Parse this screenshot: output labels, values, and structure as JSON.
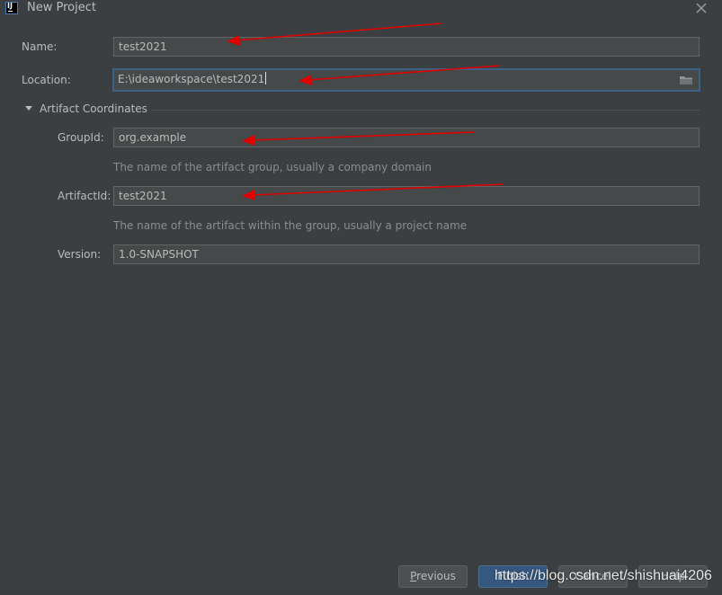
{
  "window": {
    "title": "New Project",
    "app_icon_letters": "IJ"
  },
  "form": {
    "name": {
      "label": "Name:",
      "value": "test2021"
    },
    "location": {
      "label": "Location:",
      "value": "E:\\ideaworkspace\\test2021"
    },
    "artifact_section": {
      "title": "Artifact Coordinates",
      "expanded": true
    },
    "group_id": {
      "label": "GroupId:",
      "value": "org.example",
      "hint": "The name of the artifact group, usually a company domain"
    },
    "artifact_id": {
      "label": "ArtifactId:",
      "value": "test2021",
      "hint": "The name of the artifact within the group, usually a project name"
    },
    "version": {
      "label": "Version:",
      "value": "1.0-SNAPSHOT"
    }
  },
  "buttons": {
    "previous": {
      "mnemonic": "P",
      "rest": "revious"
    },
    "finish": "Finish",
    "cancel": "Cancel",
    "help": "Help"
  },
  "watermark": "https://blog.csdn.net/shishuai4206",
  "colors": {
    "background": "#3c3f41",
    "field_background": "#45494a",
    "focus_border": "#3d6185",
    "default_button": "#365880",
    "annotation_arrow": "#e00000"
  }
}
